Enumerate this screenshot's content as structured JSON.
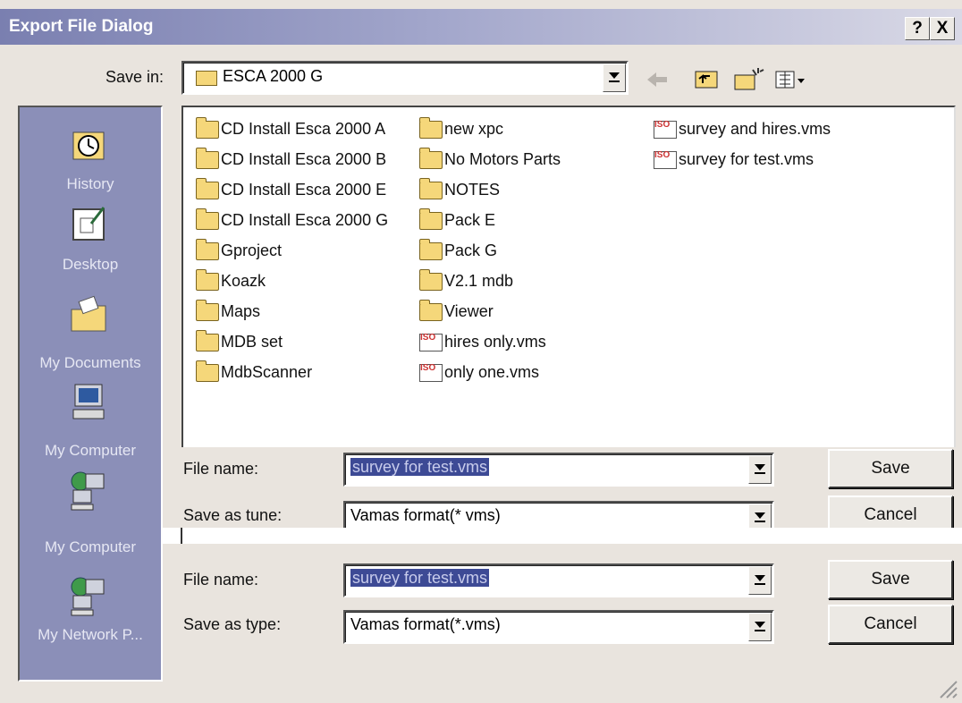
{
  "window": {
    "title": "Export File Dialog",
    "help_label": "?",
    "close_label": "X"
  },
  "save_in": {
    "label": "Save in:",
    "value": "ESCA 2000 G"
  },
  "toolbar": {
    "back_icon": "back-arrow-icon",
    "up_icon": "up-one-level-icon",
    "new_folder_icon": "new-folder-icon",
    "view_icon": "view-menu-icon"
  },
  "places": [
    {
      "label": "History",
      "icon": "history-icon"
    },
    {
      "label": "Desktop",
      "icon": "desktop-icon"
    },
    {
      "label": "My Documents",
      "icon": "my-documents-icon"
    },
    {
      "label": "My Computer",
      "icon": "my-computer-icon"
    },
    {
      "label": "My Computer",
      "icon": "network-computer-icon"
    },
    {
      "label": "My Network P...",
      "icon": "network-places-icon"
    }
  ],
  "files": {
    "col1": [
      {
        "name": "CD Install Esca 2000 A",
        "type": "folder"
      },
      {
        "name": "CD Install Esca 2000 B",
        "type": "folder"
      },
      {
        "name": "CD Install Esca 2000 E",
        "type": "folder"
      },
      {
        "name": "CD Install Esca 2000 G",
        "type": "folder"
      },
      {
        "name": "Gproject",
        "type": "folder"
      },
      {
        "name": "Koazk",
        "type": "folder"
      },
      {
        "name": "Maps",
        "type": "folder"
      },
      {
        "name": "MDB set",
        "type": "folder"
      },
      {
        "name": "MdbScanner",
        "type": "folder"
      }
    ],
    "col2": [
      {
        "name": "new xpc",
        "type": "folder"
      },
      {
        "name": "No Motors Parts",
        "type": "folder"
      },
      {
        "name": "NOTES",
        "type": "folder"
      },
      {
        "name": "Pack E",
        "type": "folder"
      },
      {
        "name": "Pack G",
        "type": "folder"
      },
      {
        "name": "V2.1 mdb",
        "type": "folder"
      },
      {
        "name": "Viewer",
        "type": "folder"
      },
      {
        "name": "hires only.vms",
        "type": "vms"
      },
      {
        "name": "only one.vms",
        "type": "vms"
      }
    ],
    "col3": [
      {
        "name": "survey and hires.vms",
        "type": "vms"
      },
      {
        "name": "survey for test.vms",
        "type": "vms"
      }
    ]
  },
  "form_top": {
    "file_name_label": "File name:",
    "file_name_value": "survey for test.vms",
    "save_as_type_label": "Save as tune:",
    "save_as_type_value": "Vamas format(* vms)",
    "save_button": "Save",
    "cancel_button": "Cancel"
  },
  "form_bottom": {
    "file_name_label": "File name:",
    "file_name_value": "survey for test.vms",
    "save_as_type_label": "Save as type:",
    "save_as_type_value": "Vamas format(*.vms)",
    "save_button": "Save",
    "cancel_button": "Cancel"
  }
}
